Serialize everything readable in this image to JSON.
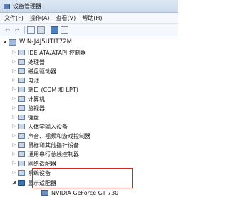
{
  "window": {
    "title": "设备管理器"
  },
  "menu": [
    {
      "name": "menu-file",
      "label": "文件(F)"
    },
    {
      "name": "menu-action",
      "label": "操作(A)"
    },
    {
      "name": "menu-view",
      "label": "查看(V)"
    },
    {
      "name": "menu-help",
      "label": "帮助(H)"
    }
  ],
  "toolbar": {
    "back_icon": "back-arrow-icon",
    "forward_icon": "forward-arrow-icon",
    "back_glyph": "⇦",
    "forward_glyph": "⇨"
  },
  "tree": {
    "root": "WIN-J4J5UTIT72M",
    "categories": [
      "IDE ATA/ATAPI 控制器",
      "处理器",
      "磁盘驱动器",
      "电池",
      "端口 (COM 和 LPT)",
      "计算机",
      "监视器",
      "键盘",
      "人体学输入设备",
      "声音、视频和游戏控制器",
      "鼠标和其他指针设备",
      "通用串行总线控制器",
      "网络适配器",
      "系统设备",
      "显示适配器"
    ],
    "expanded_child": "NVIDIA GeForce GT 730",
    "collapsed_glyph": "▷",
    "expanded_glyph": "◢"
  },
  "colors": {
    "highlight": "#d9261c",
    "accent": "#3f73b8"
  }
}
